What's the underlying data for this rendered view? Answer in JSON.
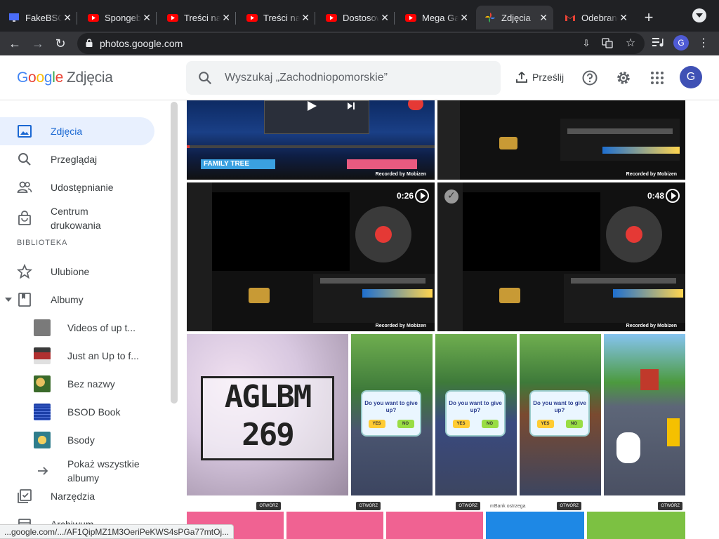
{
  "browser": {
    "tabs": [
      {
        "title": "FakeBSOD",
        "icon": "monitor-icon",
        "active": false
      },
      {
        "title": "Spongebob",
        "icon": "youtube-icon",
        "active": false
      },
      {
        "title": "Treści na kanale",
        "icon": "youtube-icon",
        "active": false
      },
      {
        "title": "Treści na kanale",
        "icon": "youtube-icon",
        "active": false
      },
      {
        "title": "Dostosowywanie",
        "icon": "youtube-icon",
        "active": false
      },
      {
        "title": "Mega Gaming",
        "icon": "youtube-icon",
        "active": false
      },
      {
        "title": "Zdjęcia",
        "icon": "google-photos-icon",
        "active": true
      },
      {
        "title": "Odebrane",
        "icon": "gmail-icon",
        "active": false
      }
    ],
    "url": "photos.google.com",
    "profile_initial": "G",
    "status_url": "...google.com/.../AF1QipMZ1M3OeriPeKWS4sPGa77mtOj..."
  },
  "header": {
    "logo_letters": [
      "G",
      "o",
      "o",
      "g",
      "l",
      "e"
    ],
    "product": "Zdjęcia",
    "search_placeholder": "Wyszukaj „Zachodniopomorskie”",
    "upload_label": "Prześlij",
    "avatar_initial": "G"
  },
  "sidebar": {
    "items": [
      {
        "label": "Zdjęcia",
        "icon": "photo-icon",
        "active": true
      },
      {
        "label": "Przeglądaj",
        "icon": "search-icon"
      },
      {
        "label": "Udostępnianie",
        "icon": "people-icon"
      },
      {
        "label": "Centrum drukowania",
        "icon": "shopping-bag-icon"
      }
    ],
    "section_label": "BIBLIOTEKA",
    "library": [
      {
        "label": "Ulubione",
        "icon": "star-icon"
      },
      {
        "label": "Albumy",
        "icon": "album-icon"
      }
    ],
    "albums": [
      {
        "label": "Videos of up t...",
        "color": "#7a7a7a"
      },
      {
        "label": "Just an Up to f...",
        "color": "#b03030"
      },
      {
        "label": "Bez nazwy",
        "color": "#3a6a2a"
      },
      {
        "label": "BSOD Book",
        "color": "#1c3fa8"
      },
      {
        "label": "Bsody",
        "color": "#2f7d8c"
      }
    ],
    "show_all_albums": "Pokaż wszystkie albumy",
    "tools_label": "Narzędzia",
    "archive_label": "Archiwum"
  },
  "grid": {
    "videos": [
      {
        "duration": "0:26",
        "watermark": "Recorded by Mobizen"
      },
      {
        "duration": "0:48",
        "watermark": "Recorded by Mobizen"
      }
    ],
    "top_watermark": "Recorded by Mobizen",
    "family_tree_label": "FAMILY TREE",
    "aglbm_text": "AGLBM 269",
    "dialog_question": "Do you want to give up?",
    "dialog_yes": "YES",
    "dialog_no": "NO",
    "ad_button": "OTWÓRZ",
    "ad_text": "mBank ostrzega"
  }
}
